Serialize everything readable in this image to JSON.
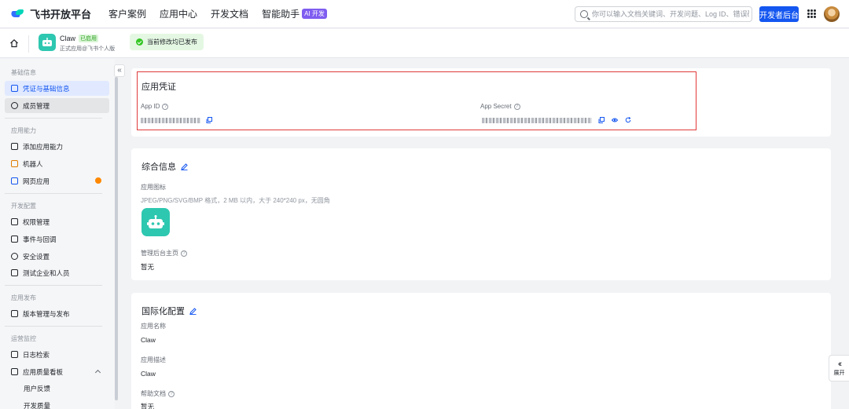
{
  "topnav": {
    "brand": "飞书开放平台",
    "links": [
      "客户案例",
      "应用中心",
      "开发文档",
      "智能助手"
    ],
    "ai_badge": "AI 开发",
    "search_placeholder": "你可以输入文档关键词、开发问题、Log ID、错误码",
    "dev_button": "开发者后台"
  },
  "subhead": {
    "app_name": "Claw",
    "app_status": "已启用",
    "app_subtitle": "正式应用@飞书个人版",
    "toast": "当前修改均已发布"
  },
  "sidebar": {
    "groups": {
      "basic": "基础信息",
      "ability": "应用能力",
      "dev": "开发配置",
      "release": "应用发布",
      "ops": "运营监控"
    },
    "items": {
      "credentials": "凭证与基础信息",
      "members": "成员管理",
      "add_ability": "添加应用能力",
      "bot": "机器人",
      "webapp": "网页应用",
      "permissions": "权限管理",
      "events": "事件与回调",
      "security": "安全设置",
      "test_company": "测试企业和人员",
      "version": "版本管理与发布",
      "logs": "日志检索",
      "quality": "应用质量看板",
      "feedback": "用户反馈",
      "dev_quality": "开发质量"
    },
    "expand_label": "展开"
  },
  "credentials_card": {
    "title": "应用凭证",
    "app_id_label": "App ID",
    "app_secret_label": "App Secret"
  },
  "general_card": {
    "title": "综合信息",
    "icon_label": "应用图标",
    "icon_hint": "JPEG/PNG/SVG/BMP 格式，2 MB 以内，大于 240*240 px，无圆角",
    "homepage_label": "管理后台主页",
    "homepage_value": "暂无"
  },
  "i18n_card": {
    "title": "国际化配置",
    "name_label": "应用名称",
    "name_value": "Claw",
    "desc_label": "应用描述",
    "desc_value": "Claw",
    "help_label": "帮助文档",
    "help_value": "暂无"
  },
  "colors": {
    "primary": "#1456f0",
    "app_teal": "#2ec7b0",
    "highlight_red": "#e03a3a",
    "success": "#34c724",
    "badge_dot": "#ff8800"
  }
}
